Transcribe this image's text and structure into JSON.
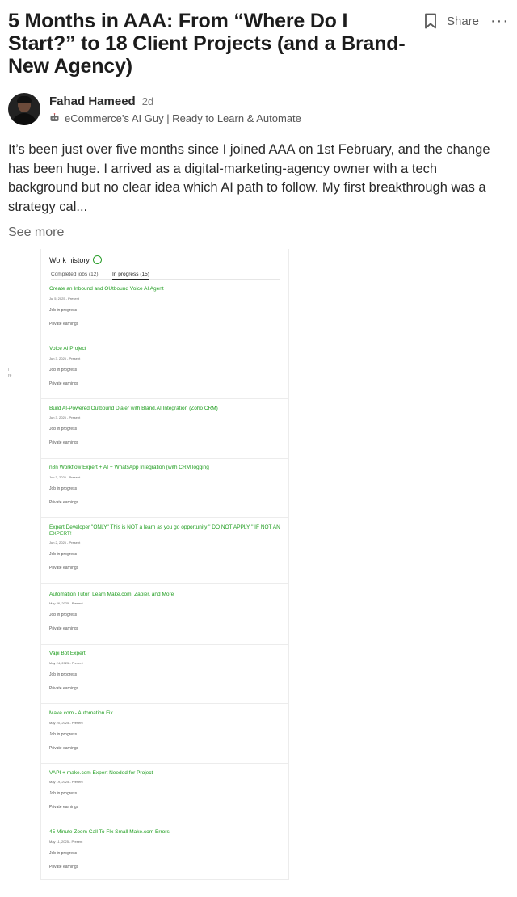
{
  "post": {
    "title": "5 Months in AAA: From “Where Do I Start?” to 18 Client Projects (and a Brand-New Agency)",
    "share_label": "Share",
    "more_label": "···",
    "author_name": "Fahad Hameed",
    "age": "2d",
    "tagline": "eCommerce’s AI Guy | Ready to Learn & Automate",
    "body": "It’s been just over five months since I joined AAA on 1st February, and the change has been huge. I arrived as a digital-marketing-agency owner with a tech background but no clear idea which AI path to follow. My first breakthrough was a strategy cal...",
    "see_more": "See more"
  },
  "icons": {
    "bookmark": "bookmark-icon",
    "more": "more-options-icon",
    "robot": "robot-icon",
    "refresh": "refresh-icon"
  },
  "colors": {
    "job_link": "#1f9d1f"
  },
  "screenshot": {
    "title": "Work history",
    "tabs": [
      "Completed jobs (12)",
      "In progress (15)"
    ],
    "stray_text": [
      "ı",
      "re"
    ],
    "jobs": [
      {
        "title": "Create an Inbound and OUtbound Voice AI Agent",
        "date": "Jul 5, 2025 - Present",
        "status": "Job in progress",
        "earnings": "Private earnings"
      },
      {
        "title": "Voice AI Project",
        "date": "Jun 3, 2025 - Present",
        "status": "Job in progress",
        "earnings": "Private earnings"
      },
      {
        "title": "Build AI-Powered Outbound Dialer with Bland.AI Integration (Zoho CRM)",
        "date": "Jun 3, 2025 - Present",
        "status": "Job in progress",
        "earnings": "Private earnings"
      },
      {
        "title": "n8n Workflow Expert + AI + WhatsApp Integration (with CRM logging",
        "date": "Jun 3, 2025 - Present",
        "status": "Job in progress",
        "earnings": "Private earnings"
      },
      {
        "title": "Expert Developer \"ONLY\" This is NOT a learn as you go opportunity \" DO NOT APPLY \" IF NOT AN EXPERT!",
        "date": "Jun 2, 2025 - Present",
        "status": "Job in progress",
        "earnings": "Private earnings"
      },
      {
        "title": "Automation Tutor: Learn Make.com, Zapier, and More",
        "date": "May 26, 2025 - Present",
        "status": "Job in progress",
        "earnings": "Private earnings"
      },
      {
        "title": "Vapi Bot Expert",
        "date": "May 24, 2025 - Present",
        "status": "Job in progress",
        "earnings": "Private earnings"
      },
      {
        "title": "Make.com - Automation Fix",
        "date": "May 20, 2025 - Present",
        "status": "Job in progress",
        "earnings": "Private earnings"
      },
      {
        "title": "VAPI + make.com Expert Needed for Project",
        "date": "May 19, 2025 - Present",
        "status": "Job in progress",
        "earnings": "Private earnings"
      },
      {
        "title": "45 Minute Zoom Call To FIx Small Make.com Errors",
        "date": "May 11, 2025 - Present",
        "status": "Job in progress",
        "earnings": "Private earnings"
      }
    ]
  }
}
